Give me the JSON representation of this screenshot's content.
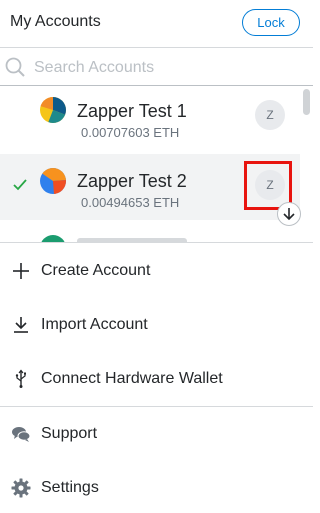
{
  "header": {
    "title": "My Accounts",
    "lock_label": "Lock"
  },
  "search": {
    "placeholder": "Search Accounts"
  },
  "accounts": [
    {
      "name": "Zapper Test 1",
      "balance": "0.00707603 ETH",
      "badge": "Z",
      "selected": false
    },
    {
      "name": "Zapper Test 2",
      "balance": "0.00494653 ETH",
      "badge": "Z",
      "selected": true
    }
  ],
  "menu": {
    "create_account": "Create Account",
    "import_account": "Import Account",
    "connect_hardware": "Connect Hardware Wallet",
    "support": "Support",
    "settings": "Settings"
  },
  "colors": {
    "accent": "#037dd6",
    "selected_check": "#28a745",
    "highlight": "#e8140f"
  },
  "icons": [
    "search-icon",
    "check-icon",
    "plus-icon",
    "download-icon",
    "usb-icon",
    "chat-icon",
    "gear-icon",
    "arrow-down-icon"
  ]
}
